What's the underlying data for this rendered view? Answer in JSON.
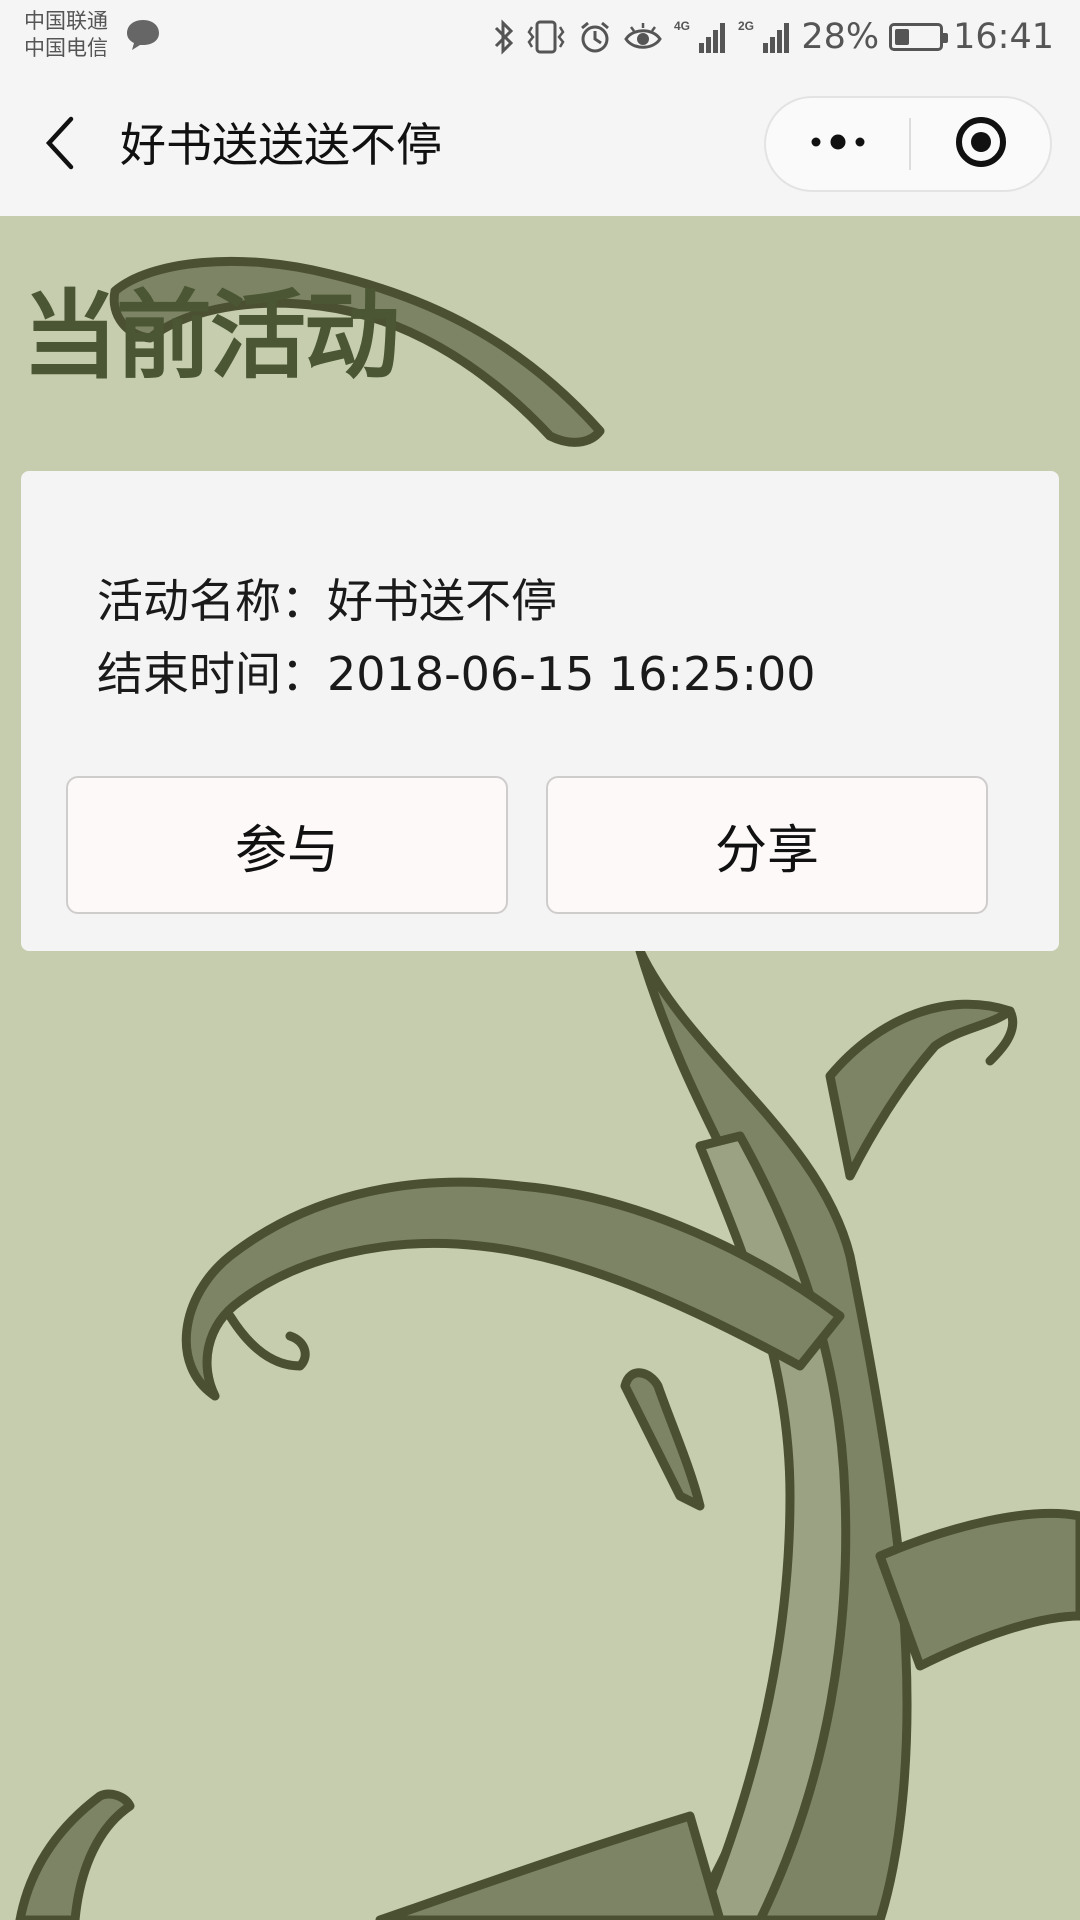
{
  "status_bar": {
    "carrier_1": "中国联通",
    "carrier_2": "中国电信",
    "network_4g": "4G",
    "network_2g": "2G",
    "battery_percent": "28%",
    "battery_level": 0.28,
    "time": "16:41",
    "icons": [
      "chat-bubble-icon",
      "bluetooth-icon",
      "vibrate-icon",
      "alarm-icon",
      "eye-icon",
      "signal-4g-icon",
      "signal-2g-icon",
      "battery-icon"
    ]
  },
  "nav": {
    "title": "好书送送送不停",
    "icons": [
      "back-arrow-icon",
      "more-dots-icon",
      "close-target-icon"
    ]
  },
  "page": {
    "section_title": "当前活动"
  },
  "activity": {
    "name_line": "活动名称：好书送不停",
    "end_line": "结束时间：2018-06-15 16:25:00",
    "join_label": "参与",
    "share_label": "分享"
  },
  "colors": {
    "background": "#c5cdae",
    "vine_dark": "#4a5031",
    "vine_fill": "#7d8465",
    "title": "#4a5634",
    "card": "#f4f4f4",
    "button": "#fdf9f8",
    "bar": "#f5f5f5"
  }
}
